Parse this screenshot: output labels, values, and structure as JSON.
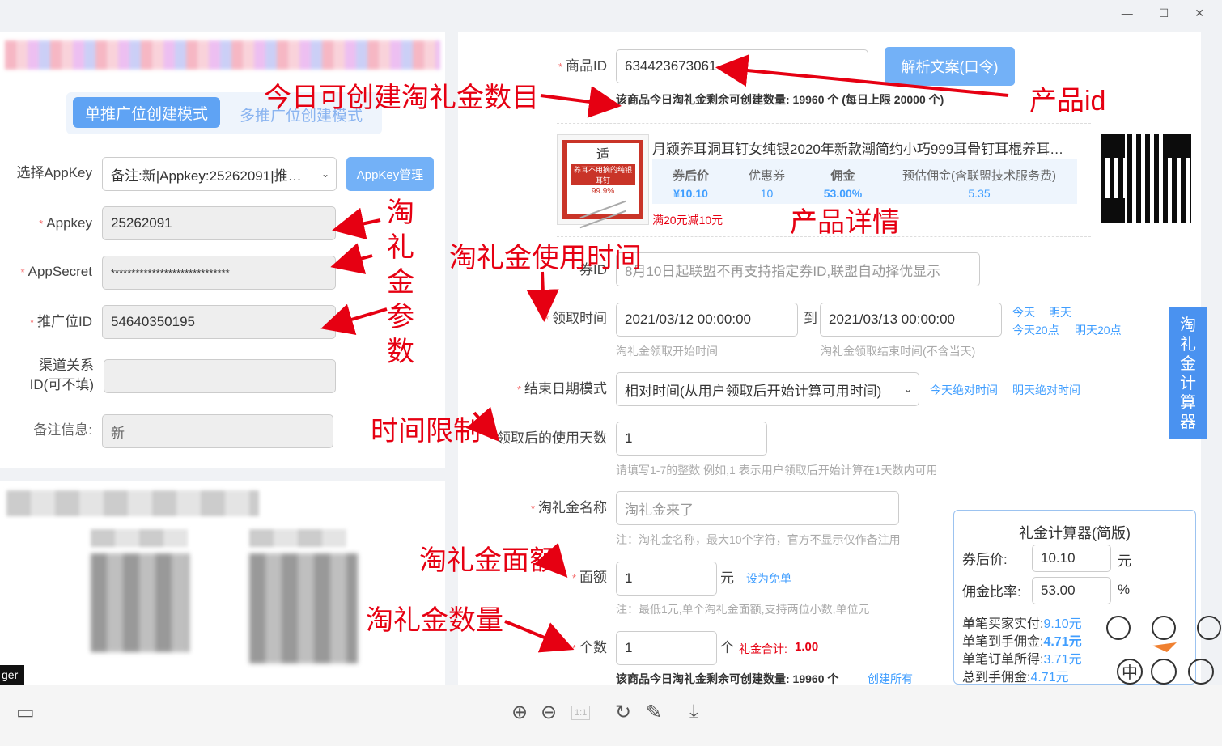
{
  "window": {
    "min": "—",
    "max": "☐",
    "close": "✕"
  },
  "left": {
    "modes": {
      "single": "单推广位创建模式",
      "multi": "多推广位创建模式"
    },
    "appkey_select": {
      "label": "选择AppKey",
      "value": "备注:新|Appkey:25262091|推…",
      "manage": "AppKey管理"
    },
    "appkey": {
      "label": "Appkey",
      "value": "25262091"
    },
    "appsecret": {
      "label": "AppSecret",
      "value": "*****************************"
    },
    "adzone": {
      "label": "推广位ID",
      "value": "54640350195"
    },
    "relation": {
      "label1": "渠道关系",
      "label2": "ID(可不填)",
      "value": ""
    },
    "remark": {
      "label": "备注信息:",
      "value": "新"
    },
    "tag": "ger"
  },
  "right": {
    "item_id": {
      "label": "商品ID",
      "value": "634423673061",
      "parse_button": "解析文案(口令)",
      "quota": "该商品今日淘礼金剩余可创建数量: 19960 个 (每日上限 20000 个)"
    },
    "product": {
      "title": "月颖养耳洞耳钉女纯银2020年新款潮简约小巧999耳骨钉耳棍养耳…",
      "img_top": "适",
      "img_line": "养耳不用摘的纯银耳钉",
      "img_price": "99.9%",
      "coupon_note": "满20元减10元",
      "stats": [
        {
          "label": "券后价",
          "value": "¥10.10"
        },
        {
          "label": "优惠券",
          "value": "10"
        },
        {
          "label": "佣金",
          "value": "53.00%"
        },
        {
          "label": "预估佣金(含联盟技术服务费)",
          "value": "5.35"
        }
      ]
    },
    "coupon_id": {
      "label": "券ID",
      "placeholder": "8月10日起联盟不再支持指定券ID,联盟自动择优显示"
    },
    "receive_time": {
      "label": "领取时间",
      "start": "2021/03/12 00:00:00",
      "to": "到",
      "end": "2021/03/13 00:00:00",
      "start_hint": "淘礼金领取开始时间",
      "end_hint": "淘礼金领取结束时间(不含当天)",
      "links": [
        "今天",
        "明天",
        "今天20点",
        "明天20点"
      ]
    },
    "end_mode": {
      "label": "结束日期模式",
      "value": "相对时间(从用户领取后开始计算可用时间)",
      "links": [
        "今天绝对时间",
        "明天绝对时间"
      ]
    },
    "use_days": {
      "label": "领取后的使用天数",
      "value": "1",
      "hint": "请填写1-7的整数 例如,1 表示用户领取后开始计算在1天数内可用"
    },
    "name": {
      "label": "淘礼金名称",
      "placeholder": "淘礼金来了",
      "hint": "注：淘礼金名称，最大10个字符，官方不显示仅作备注用"
    },
    "face": {
      "label": "面额",
      "value": "1",
      "unit": "元",
      "link": "设为免单",
      "hint": "注：最低1元,单个淘礼金面额,支持两位小数,单位元"
    },
    "count": {
      "label": "个数",
      "value": "1",
      "unit": "个",
      "total_label": "礼金合计:",
      "total": "1.00",
      "quota": "该商品今日淘礼金剩余可创建数量: 19960 个",
      "create_all": "创建所有"
    },
    "side_tab": [
      "淘",
      "礼",
      "金",
      "计",
      "算",
      "器"
    ],
    "calc": {
      "title": "礼金计算器(简版)",
      "price_label": "券后价:",
      "price": "10.10",
      "price_unit": "元",
      "rate_label": "佣金比率:",
      "rate": "53.00",
      "rate_unit": "%",
      "rows": [
        {
          "label": "单笔买家实付:",
          "value": "9.10元"
        },
        {
          "label": "单笔到手佣金:",
          "value": "4.71元"
        },
        {
          "label": "单笔订单所得:",
          "value": "3.71元"
        },
        {
          "label": "总到手佣金:",
          "value": "4.71元"
        }
      ]
    },
    "widget_glyph": "中"
  },
  "annotations": {
    "quota": "今日可创建淘礼金数目",
    "product_id": "产品id",
    "params": [
      "淘",
      "礼",
      "金",
      "参",
      "数"
    ],
    "detail": "产品详情",
    "use_time": "淘礼金使用时间",
    "time_limit": "时间限制",
    "face": "淘礼金面额",
    "count": "淘礼金数量"
  },
  "toolbar": {
    "grid": "▭",
    "zoom_in": "⊕",
    "zoom_out": "⊖",
    "actual": "1:1",
    "rotate": "↻",
    "edit": "✎",
    "download": "⤓"
  },
  "colors": {
    "accent": "#409eff",
    "annotation": "#e60012",
    "required": "#f56c6c"
  }
}
